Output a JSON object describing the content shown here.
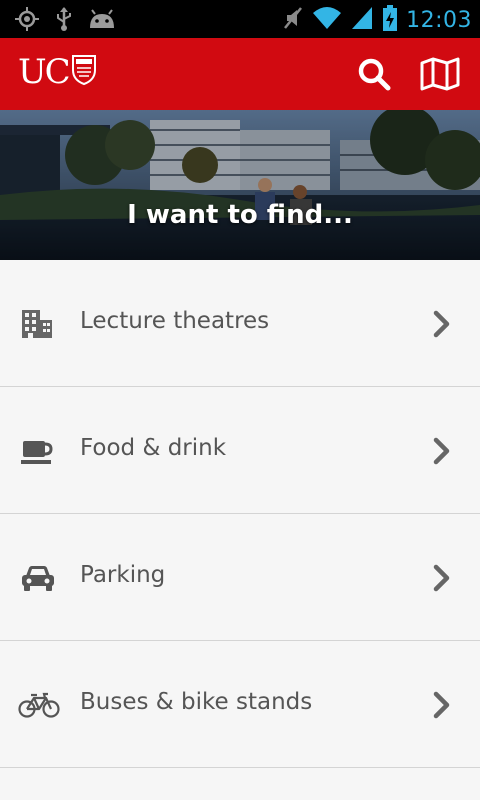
{
  "status_bar": {
    "time": "12:03",
    "icons": [
      "gps-icon",
      "usb-icon",
      "android-icon",
      "mute-icon",
      "wifi-icon",
      "signal-icon",
      "battery-charging-icon"
    ],
    "time_color": "#33b5e5"
  },
  "app_bar": {
    "logo_text": "UC",
    "background": "#d10a11",
    "actions": [
      "search-icon",
      "map-icon"
    ]
  },
  "hero": {
    "title": "I want to find..."
  },
  "menu": {
    "items": [
      {
        "label": "Lecture theatres",
        "icon": "building-icon"
      },
      {
        "label": "Food & drink",
        "icon": "coffee-cup-icon"
      },
      {
        "label": "Parking",
        "icon": "car-icon"
      },
      {
        "label": "Buses & bike stands",
        "icon": "bicycle-icon"
      }
    ]
  }
}
